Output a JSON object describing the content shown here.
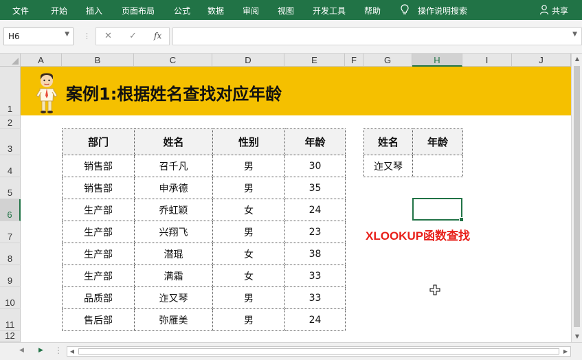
{
  "ribbon": {
    "tabs": [
      "文件",
      "开始",
      "插入",
      "页面布局",
      "公式",
      "数据",
      "审阅",
      "视图",
      "开发工具",
      "帮助"
    ],
    "tellme": "操作说明搜索",
    "share": "共享"
  },
  "formula_bar": {
    "name_box": "H6",
    "fx": "fx",
    "content": ""
  },
  "columns": [
    "A",
    "B",
    "C",
    "D",
    "E",
    "F",
    "G",
    "H",
    "I",
    "J"
  ],
  "rows": [
    "1",
    "2",
    "3",
    "4",
    "5",
    "6",
    "7",
    "8",
    "9",
    "10",
    "11",
    "12"
  ],
  "selected_cell": "H6",
  "banner": {
    "title": "案例1:根据姓名查找对应年龄"
  },
  "main_table": {
    "headers": [
      "部门",
      "姓名",
      "性别",
      "年龄"
    ],
    "rows": [
      [
        "销售部",
        "召千凡",
        "男",
        "30"
      ],
      [
        "销售部",
        "申承德",
        "男",
        "35"
      ],
      [
        "生产部",
        "乔虹颖",
        "女",
        "24"
      ],
      [
        "生产部",
        "兴翔飞",
        "男",
        "23"
      ],
      [
        "生产部",
        "潜琨",
        "女",
        "38"
      ],
      [
        "生产部",
        "满霜",
        "女",
        "33"
      ],
      [
        "品质部",
        "迮又琴",
        "男",
        "33"
      ],
      [
        "售后部",
        "弥雁美",
        "男",
        "24"
      ]
    ]
  },
  "lookup_table": {
    "headers": [
      "姓名",
      "年龄"
    ],
    "name": "迮又琴",
    "age": ""
  },
  "note": "XLOOKUP函数查找",
  "colors": {
    "ribbon": "#217346",
    "banner": "#f5c000",
    "note": "#e8201a",
    "selection": "#217346"
  }
}
